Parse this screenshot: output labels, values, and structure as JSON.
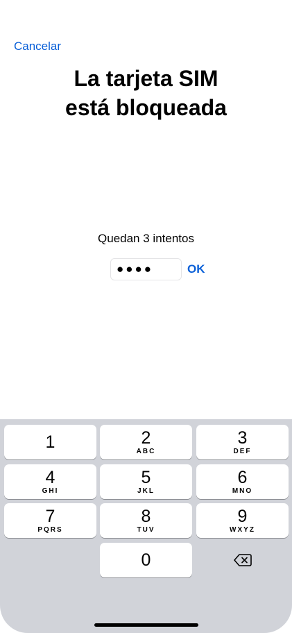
{
  "header": {
    "cancel_label": "Cancelar",
    "title_line1": "La tarjeta SIM",
    "title_line2": "está bloqueada"
  },
  "pin": {
    "attempts_text": "Quedan 3 intentos",
    "masked_value": "●●●●",
    "ok_label": "OK"
  },
  "keypad": {
    "keys": [
      {
        "digit": "1",
        "letters": ""
      },
      {
        "digit": "2",
        "letters": "ABC"
      },
      {
        "digit": "3",
        "letters": "DEF"
      },
      {
        "digit": "4",
        "letters": "GHI"
      },
      {
        "digit": "5",
        "letters": "JKL"
      },
      {
        "digit": "6",
        "letters": "MNO"
      },
      {
        "digit": "7",
        "letters": "PQRS"
      },
      {
        "digit": "8",
        "letters": "TUV"
      },
      {
        "digit": "9",
        "letters": "WXYZ"
      },
      {
        "digit": "0",
        "letters": ""
      }
    ],
    "backspace_icon": "delete-left-icon"
  },
  "colors": {
    "accent": "#0a60d8",
    "keyboard_bg": "#d1d3d9"
  }
}
